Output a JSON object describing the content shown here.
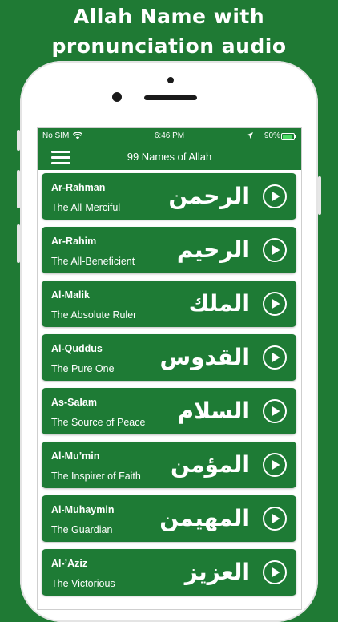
{
  "promo": {
    "line1": "Allah Name with",
    "line2": "pronunciation audio"
  },
  "status_bar": {
    "carrier": "No SIM",
    "time": "6:46 PM",
    "battery": "90%"
  },
  "nav": {
    "title": "99 Names of Allah",
    "menu_icon": "hamburger-menu-icon"
  },
  "names": [
    {
      "transliteration": "Ar-Rahman",
      "meaning": "The All-Merciful",
      "arabic": "الرحمن"
    },
    {
      "transliteration": "Ar-Rahim",
      "meaning": "The All-Beneficient",
      "arabic": "الرحيم"
    },
    {
      "transliteration": "Al-Malik",
      "meaning": "The Absolute Ruler",
      "arabic": "الملك"
    },
    {
      "transliteration": "Al-Quddus",
      "meaning": "The Pure One",
      "arabic": "القدوس"
    },
    {
      "transliteration": "As-Salam",
      "meaning": "The Source of Peace",
      "arabic": "السلام"
    },
    {
      "transliteration": "Al-Mu’min",
      "meaning": "The Inspirer of Faith",
      "arabic": "المؤمن"
    },
    {
      "transliteration": "Al-Muhaymin",
      "meaning": "The Guardian",
      "arabic": "المهيمن"
    },
    {
      "transliteration": "Al-’Aziz",
      "meaning": "The Victorious",
      "arabic": "العزيز"
    }
  ],
  "colors": {
    "background": "#1f7a34",
    "brand": "#1e7b35",
    "text": "#ffffff"
  }
}
